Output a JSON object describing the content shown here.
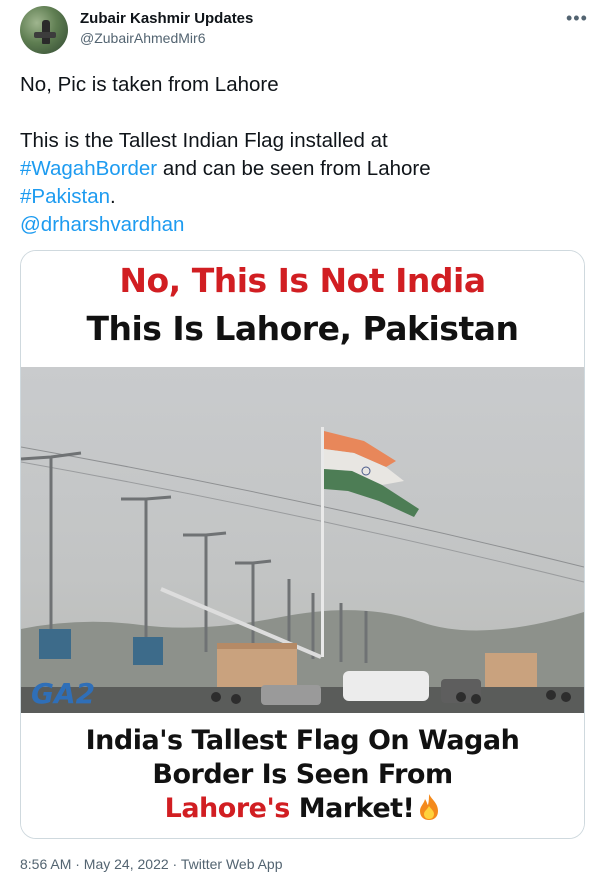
{
  "author": {
    "name": "Zubair Kashmir Updates",
    "handle": "@ZubairAhmedMir6"
  },
  "menu_icon": "more-horizontal-icon",
  "tweet": {
    "line1": "No, Pic is taken from Lahore",
    "line2": "This is the Tallest Indian Flag installed at",
    "hashtag1": "#WagahBorder",
    "line3_rest": " and can be seen from Lahore",
    "hashtag2": "#Pakistan",
    "line4_rest": ".",
    "mention": "@drharshvardhan"
  },
  "media": {
    "top_line1": "No, This Is Not India",
    "top_line2": "This Is Lahore, Pakistan",
    "bottom_line1": "India's Tallest Flag On Wagah",
    "bottom_line2": "Border Is Seen From",
    "bottom_line3_red": "Lahore's",
    "bottom_line3_black": " Market!",
    "channel_logo": "GA2",
    "fire_icon": "fire-icon"
  },
  "footer": {
    "meta": "8:56 AM · May 24, 2022 · Twitter Web App"
  },
  "colors": {
    "link": "#1d9bf0",
    "headline_red": "#d11e22",
    "muted": "#536471"
  }
}
